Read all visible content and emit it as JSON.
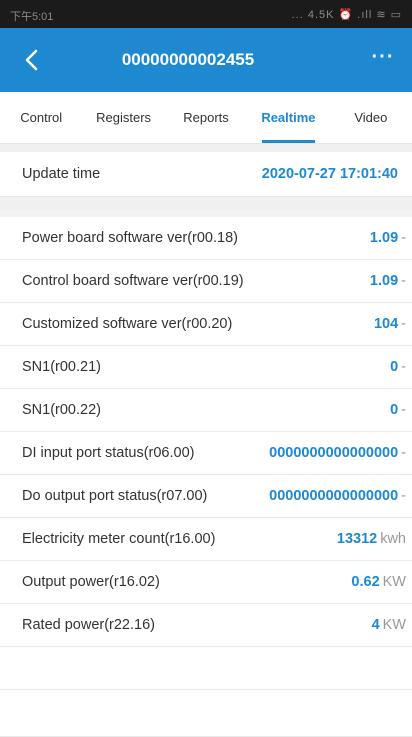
{
  "status": {
    "time": "下午5:01",
    "icons": "... 4.5K ⏰ .ıll ≋ ▭"
  },
  "header": {
    "title": "00000000002455",
    "more": "···"
  },
  "tabs": [
    {
      "label": "Control"
    },
    {
      "label": "Registers"
    },
    {
      "label": "Reports"
    },
    {
      "label": "Realtime"
    },
    {
      "label": "Video"
    }
  ],
  "update": {
    "label": "Update time",
    "value": "2020-07-27 17:01:40"
  },
  "rows": [
    {
      "label": "Power board software ver(r00.18)",
      "value": "1.09",
      "unit": "-"
    },
    {
      "label": "Control board software ver(r00.19)",
      "value": "1.09",
      "unit": "-"
    },
    {
      "label": "Customized software ver(r00.20)",
      "value": "104",
      "unit": "-"
    },
    {
      "label": "SN1(r00.21)",
      "value": "0",
      "unit": "-"
    },
    {
      "label": "SN1(r00.22)",
      "value": "0",
      "unit": "-"
    },
    {
      "label": "DI input port status(r06.00)",
      "value": "0000000000000000",
      "unit": "-"
    },
    {
      "label": "Do output port status(r07.00)",
      "value": "0000000000000000",
      "unit": "-"
    },
    {
      "label": "Electricity meter count(r16.00)",
      "value": "13312",
      "unit": "kwh"
    },
    {
      "label": "Output power(r16.02)",
      "value": "0.62",
      "unit": "KW"
    },
    {
      "label": "Rated power(r22.16)",
      "value": "4",
      "unit": "KW"
    }
  ],
  "colors": {
    "accent": "#1e88d0",
    "statusbar": "#1b1b1b"
  }
}
